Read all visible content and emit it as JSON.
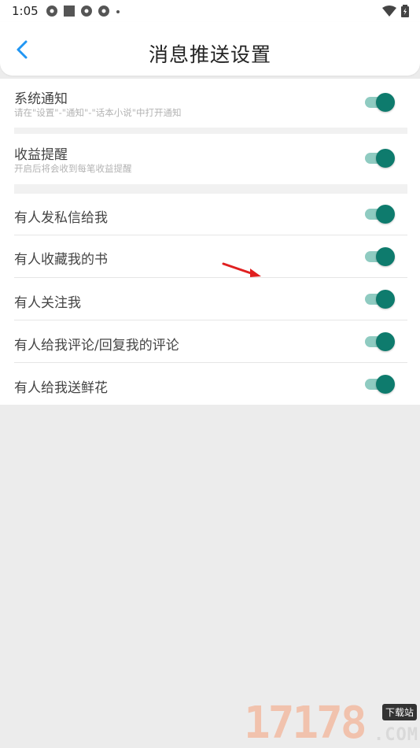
{
  "status_bar": {
    "time": "1:05",
    "notification_icons": [
      "gear-app-icon",
      "square-app-icon",
      "gear-app-icon",
      "gear-app-icon",
      "dot-icon"
    ],
    "right_icons": [
      "wifi-icon",
      "battery-icon"
    ]
  },
  "header": {
    "title": "消息推送设置"
  },
  "settings": [
    {
      "title": "系统通知",
      "subtitle": "请在\"设置\"-\"通知\"-\"话本小说\"中打开通知",
      "enabled": true
    },
    {
      "title": "收益提醒",
      "subtitle": "开启后将会收到每笔收益提醒",
      "enabled": true
    },
    {
      "title": "有人发私信给我",
      "enabled": true
    },
    {
      "title": "有人收藏我的书",
      "enabled": true
    },
    {
      "title": "有人关注我",
      "enabled": true
    },
    {
      "title": "有人给我评论/回复我的评论",
      "enabled": true
    },
    {
      "title": "有人给我送鲜花",
      "enabled": true
    }
  ],
  "colors": {
    "accent": "#0e7b6d",
    "toggle_track": "#8fcbc1",
    "back_arrow": "#2196f3",
    "annotation_arrow": "#e02020"
  },
  "watermark": {
    "number": "17178",
    "tag": "下载站",
    "suffix": ".COM"
  }
}
